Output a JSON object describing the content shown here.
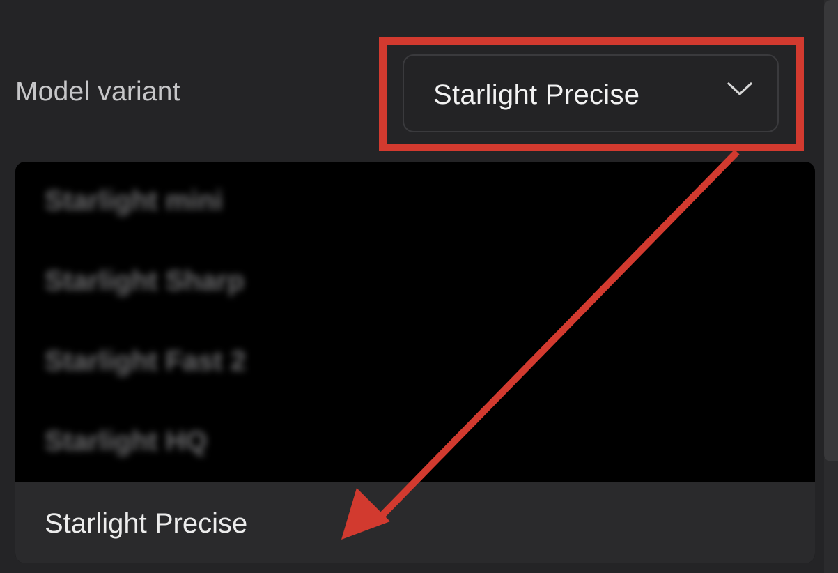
{
  "field": {
    "label": "Model variant",
    "selected_value": "Starlight Precise",
    "chevron_icon": "chevron-down-icon"
  },
  "dropdown": {
    "options": [
      {
        "label": "Starlight mini",
        "state": "blurred"
      },
      {
        "label": "Starlight Sharp",
        "state": "blurred"
      },
      {
        "label": "Starlight Fast 2",
        "state": "blurred"
      },
      {
        "label": "Starlight HQ",
        "state": "blurred"
      },
      {
        "label": "Starlight Precise",
        "state": "selected"
      }
    ]
  },
  "annotation": {
    "color": "#d23a2f",
    "type": "highlight-box-with-arrow"
  },
  "colors": {
    "background": "#242426",
    "dropdown_background": "#000000",
    "selected_row": "#2a2a2c",
    "text": "#f2f2f2"
  }
}
